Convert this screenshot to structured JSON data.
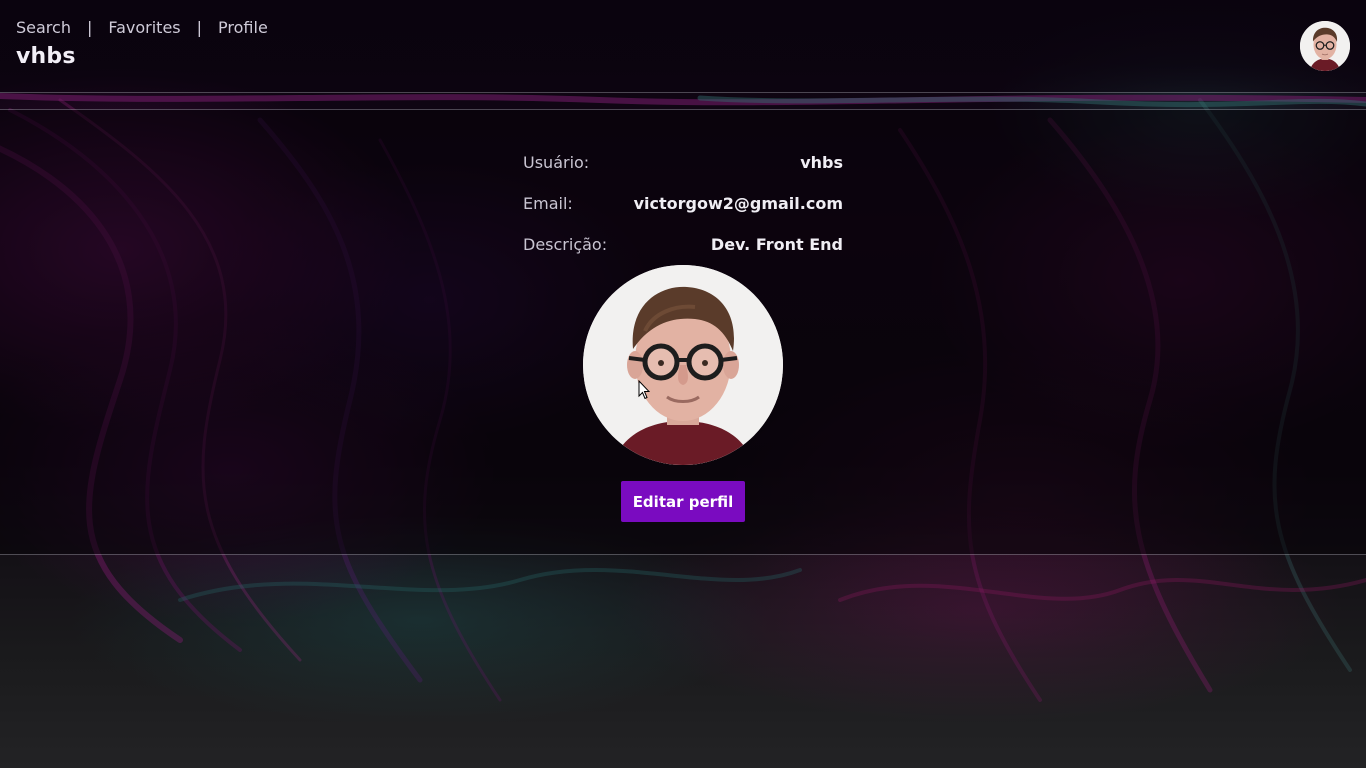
{
  "nav": {
    "links": [
      "Search",
      "Favorites",
      "Profile"
    ],
    "separator": "|"
  },
  "brand": "vhbs",
  "profile": {
    "fields": [
      {
        "label": "Usuário:",
        "value": "vhbs"
      },
      {
        "label": "Email:",
        "value": "victorgow2@gmail.com"
      },
      {
        "label": "Descrição:",
        "value": "Dev. Front End"
      }
    ],
    "edit_button": "Editar perfil"
  },
  "icons": {
    "header_avatar": "user-photo",
    "profile_photo": "user-photo",
    "cursor": "mouse-pointer-icon"
  },
  "colors": {
    "accent": "#7a0bc0",
    "background": "#0b0410",
    "text": "#e9e6f0"
  }
}
